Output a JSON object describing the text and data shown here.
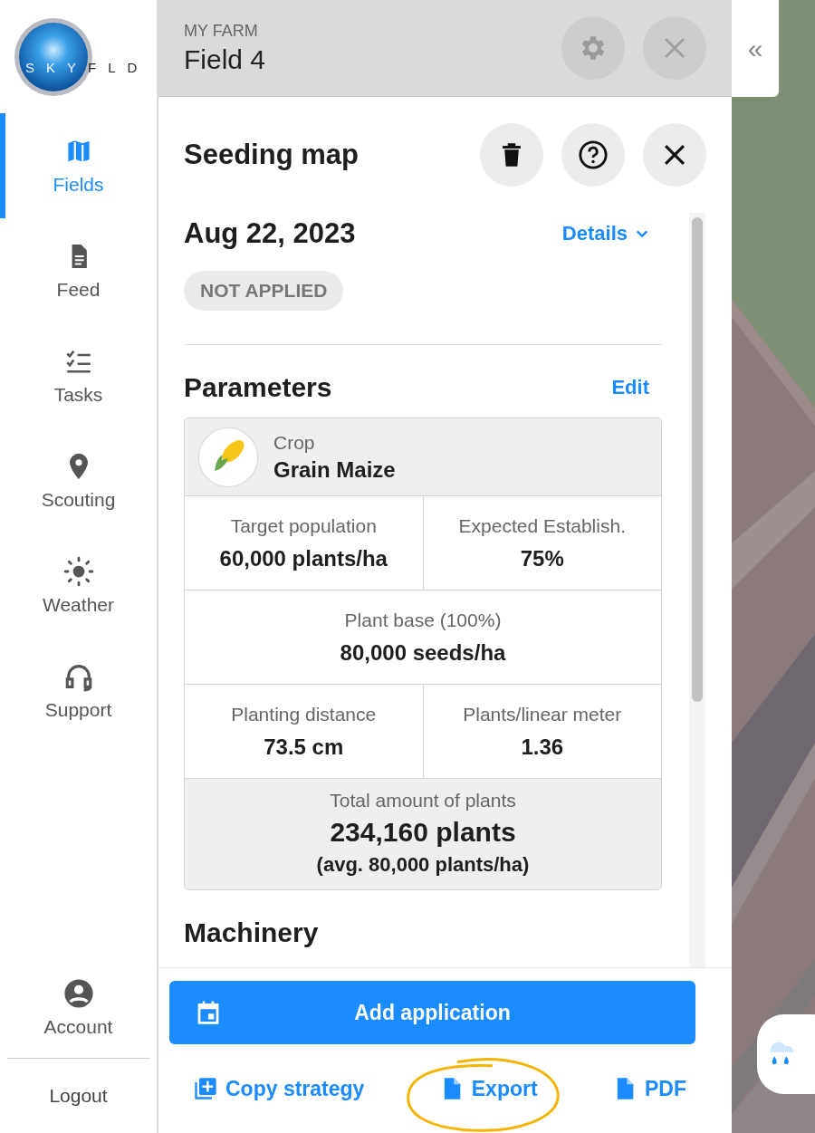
{
  "logo": {
    "text": "SKYFLD"
  },
  "nav": [
    {
      "label": "Fields",
      "selected": true
    },
    {
      "label": "Feed",
      "selected": false
    },
    {
      "label": "Tasks",
      "selected": false
    },
    {
      "label": "Scouting",
      "selected": false
    },
    {
      "label": "Weather",
      "selected": false
    },
    {
      "label": "Support",
      "selected": false
    }
  ],
  "account": {
    "label": "Account"
  },
  "logout": {
    "label": "Logout"
  },
  "header": {
    "overline": "MY FARM",
    "title": "Field 4"
  },
  "panel": {
    "title": "Seeding map",
    "date": "Aug 22, 2023",
    "details_link": "Details",
    "status": "NOT APPLIED",
    "parameters": {
      "title": "Parameters",
      "edit": "Edit",
      "crop": {
        "label": "Crop",
        "value": "Grain Maize"
      },
      "rows": [
        [
          {
            "label": "Target population",
            "value": "60,000 plants/ha"
          },
          {
            "label": "Expected Establish.",
            "value": "75%"
          }
        ],
        [
          {
            "label": "Plant base (100%)",
            "value": "80,000 seeds/ha"
          }
        ],
        [
          {
            "label": "Planting distance",
            "value": "73.5 cm"
          },
          {
            "label": "Plants/linear meter",
            "value": "1.36"
          }
        ]
      ],
      "total": {
        "label": "Total amount of plants",
        "value": "234,160 plants",
        "note": "(avg. 80,000 plants/ha)"
      }
    },
    "next_section": "Machinery"
  },
  "actions": {
    "primary": "Add application",
    "links": [
      "Copy strategy",
      "Export",
      "PDF"
    ]
  },
  "collapse": {
    "label": "«"
  }
}
